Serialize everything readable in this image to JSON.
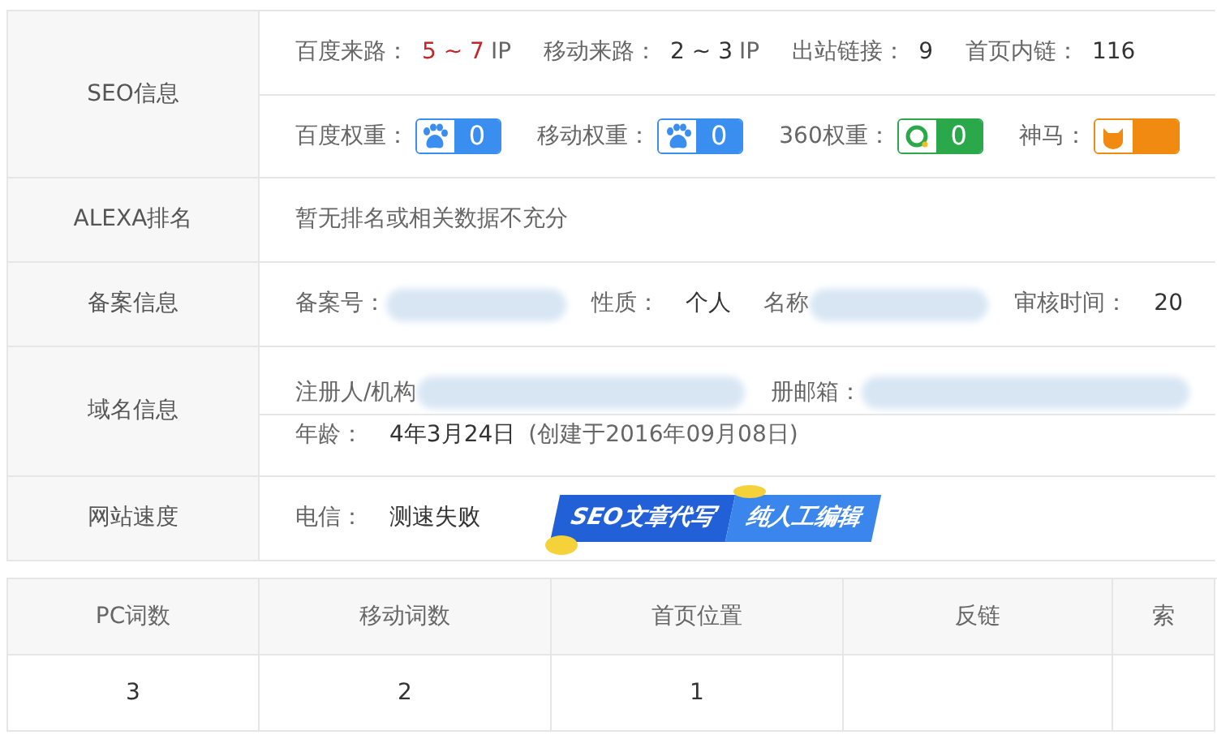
{
  "info_table": {
    "seo": {
      "label": "SEO信息",
      "traffic": [
        {
          "label": "百度来路：",
          "value": "5 ~ 7",
          "unit": "IP",
          "highlight": true
        },
        {
          "label": "移动来路：",
          "value": "2 ~ 3",
          "unit": "IP",
          "highlight": false
        },
        {
          "label": "出站链接：",
          "value": "9",
          "highlight": false
        },
        {
          "label": "首页内链：",
          "value": "116",
          "highlight": false
        }
      ],
      "weights": [
        {
          "label": "百度权重：",
          "kind": "baidu",
          "color": "#3a8ef0",
          "value": "0"
        },
        {
          "label": "移动权重：",
          "kind": "baidu-mobile",
          "color": "#3a8ef0",
          "value": "0"
        },
        {
          "label": "360权重：",
          "kind": "ring",
          "color": "#2aa84a",
          "value": "0"
        },
        {
          "label": "神马：",
          "kind": "shenma",
          "color": "#f08a10"
        }
      ]
    },
    "rows": [
      {
        "label": "ALEXA排名",
        "lines": [
          [
            {
              "kind": "text",
              "text": "暂无排名或相关数据不充分"
            }
          ]
        ]
      },
      {
        "label": "备案信息",
        "lines": [
          [
            {
              "kind": "field",
              "label": "备案号："
            },
            {
              "kind": "redacted"
            },
            {
              "kind": "field",
              "label": "性质：",
              "value": "个人"
            },
            {
              "kind": "field",
              "label": "名称"
            },
            {
              "kind": "redacted"
            },
            {
              "kind": "field",
              "label": "审核时间：",
              "value": "20"
            }
          ]
        ]
      },
      {
        "label": "域名信息",
        "lines": [
          [
            {
              "kind": "field",
              "label": "注册人/机构"
            },
            {
              "kind": "redacted"
            },
            {
              "kind": "field",
              "label": "册邮箱："
            },
            {
              "kind": "redacted"
            }
          ],
          [
            {
              "kind": "field",
              "label": "年龄：",
              "value": "4年3月24日",
              "note": "(创建于2016年09月08日)"
            }
          ]
        ]
      },
      {
        "label": "网站速度",
        "lines": [
          [
            {
              "kind": "field",
              "label": "电信：",
              "value": "测速失败"
            },
            {
              "kind": "banner",
              "parts": [
                "SEO文章代写",
                "纯人工编辑"
              ]
            }
          ]
        ]
      }
    ]
  },
  "stats_table": {
    "columns": [
      "PC词数",
      "移动词数",
      "首页位置",
      "反链",
      "索"
    ],
    "rows": [
      [
        "3",
        "2",
        "1",
        "",
        ""
      ]
    ]
  }
}
